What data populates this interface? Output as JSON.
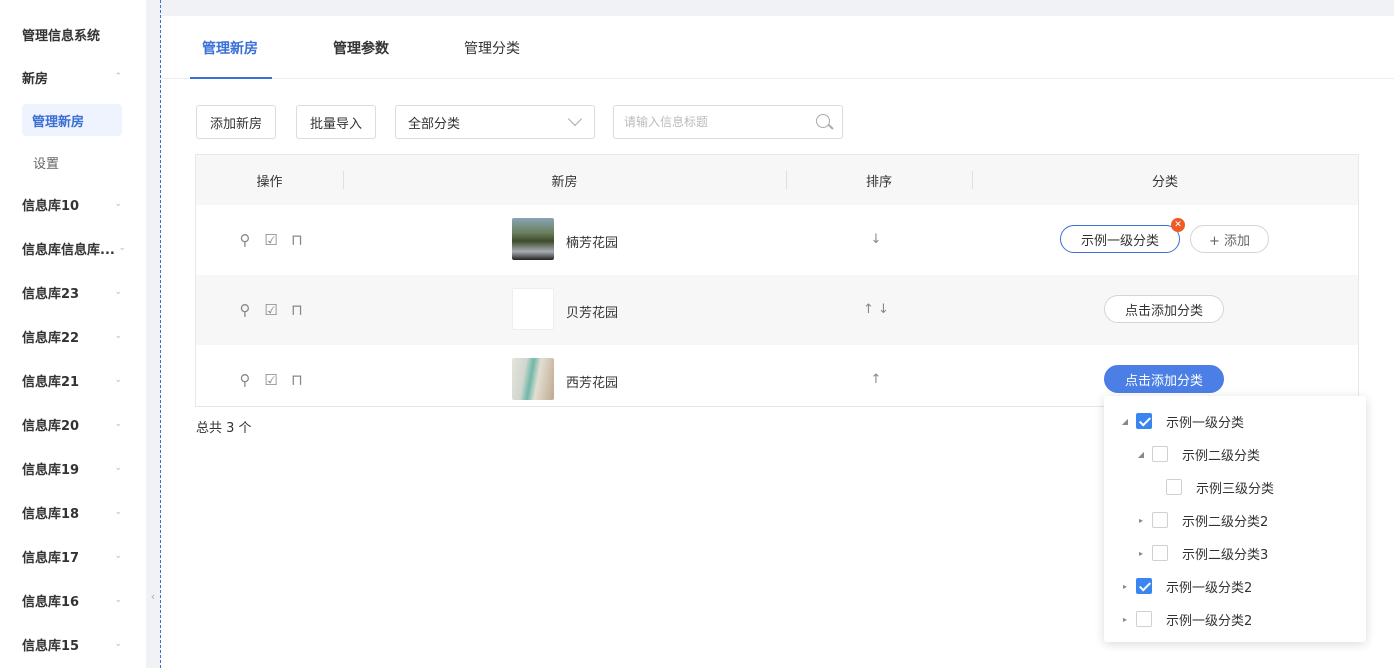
{
  "sidebar": {
    "app_title": "管理信息系统",
    "section": "新房",
    "active_item": "管理新房",
    "setting_item": "设置",
    "items": [
      "信息库10",
      "信息库信息库...",
      "信息库23",
      "信息库22",
      "信息库21",
      "信息库20",
      "信息库19",
      "信息库18",
      "信息库17",
      "信息库16",
      "信息库15"
    ],
    "collapse_glyph": "‹"
  },
  "tabs": [
    "管理新房",
    "管理参数",
    "管理分类"
  ],
  "toolbar": {
    "add_label": "添加新房",
    "import_label": "批量导入",
    "category_select": "全部分类",
    "search_placeholder": "请输入信息标题"
  },
  "table": {
    "headers": [
      "操作",
      "新房",
      "排序",
      "分类"
    ],
    "rows": [
      {
        "name": "楠芳花园",
        "sort": "↓"
      },
      {
        "name": "贝芳花园",
        "sort": "↑ ↓"
      },
      {
        "name": "西芳花园",
        "sort": "↑"
      }
    ],
    "row1_category": "示例一级分类",
    "add_label": "+ 添加",
    "click_add_label": "点击添加分类"
  },
  "total_text": "总共 3 个",
  "tree": [
    {
      "label": "示例一级分类",
      "checked": true
    },
    {
      "label": "示例二级分类",
      "checked": false
    },
    {
      "label": "示例三级分类",
      "checked": false
    },
    {
      "label": "示例二级分类2",
      "checked": false
    },
    {
      "label": "示例二级分类3",
      "checked": false
    },
    {
      "label": "示例一级分类2",
      "checked": true
    },
    {
      "label": "示例一级分类2",
      "checked": false
    }
  ],
  "colors": {
    "accent": "#3a6fd8",
    "primary_button": "#4b7fe5",
    "badge": "#ee5a24"
  },
  "icons": [
    "search-icon",
    "edit-icon",
    "delete-icon",
    "chevron-down-icon",
    "close-icon",
    "checkbox-icon"
  ]
}
